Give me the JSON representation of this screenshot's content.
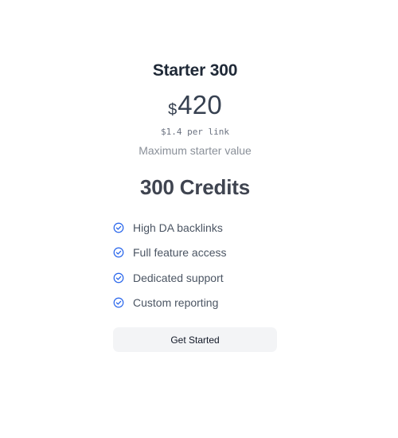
{
  "plan": {
    "title": "Starter 300",
    "currency": "$",
    "price": "420",
    "per_link": "$1.4 per link",
    "subtitle": "Maximum starter value",
    "credits": "300 Credits",
    "features": [
      {
        "label": "High DA backlinks",
        "icon": "check-circle-icon"
      },
      {
        "label": "Full feature access",
        "icon": "check-circle-icon"
      },
      {
        "label": "Dedicated support",
        "icon": "check-circle-icon"
      },
      {
        "label": "Custom reporting",
        "icon": "check-circle-icon"
      }
    ],
    "cta_label": "Get Started"
  },
  "colors": {
    "accent": "#2563eb",
    "button_bg": "#f3f4f6",
    "title_text": "#1f2937",
    "muted_text": "#8a9099"
  }
}
